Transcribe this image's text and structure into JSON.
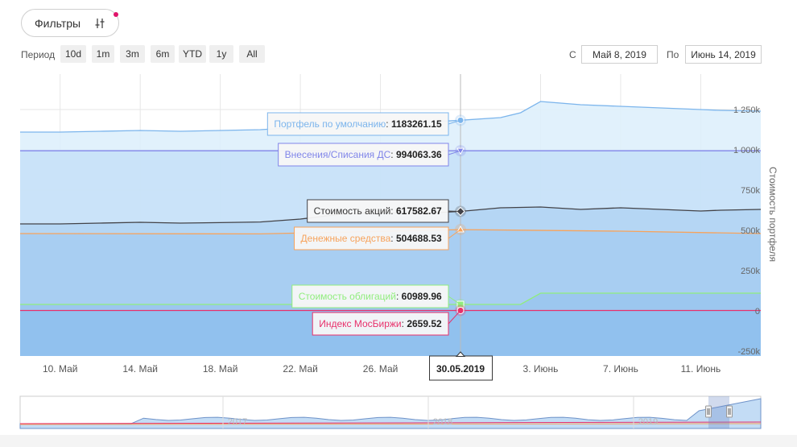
{
  "toolbar": {
    "filters_label": "Фильтры",
    "filters_icon": "sliders-icon",
    "period_label": "Период",
    "periods": [
      "10d",
      "1m",
      "3m",
      "6m",
      "YTD",
      "1y",
      "All"
    ],
    "from_label": "С",
    "from_value": "Май 8, 2019",
    "to_label": "По",
    "to_value": "Июнь 14, 2019"
  },
  "colors": {
    "accent": "#e0146a",
    "portfolio": "#7cb5ec",
    "deposits": "#8085e9",
    "stocks": "#434348",
    "cash": "#f7a35c",
    "bonds": "#90ed7d",
    "index": "#e8306b"
  },
  "chart_data": {
    "type": "area",
    "ylabel": "Стоимость портфеля",
    "ylim": [
      -250000,
      1400000
    ],
    "yticks": [
      -250000,
      0,
      250000,
      500000,
      750000,
      1000000,
      1250000
    ],
    "ytick_labels": [
      "-250k",
      "0",
      "250k",
      "500k",
      "750k",
      "1 000k",
      "1 250k"
    ],
    "x_start": "2019-05-08",
    "x_end": "2019-06-14",
    "xtick_dates": [
      "2019-05-10",
      "2019-05-14",
      "2019-05-18",
      "2019-05-22",
      "2019-05-26",
      "2019-06-03",
      "2019-06-07",
      "2019-06-11"
    ],
    "xtick_labels": [
      "10. Май",
      "14. Май",
      "18. Май",
      "22. Май",
      "26. Май",
      "3. Июнь",
      "7. Июнь",
      "11. Июнь"
    ],
    "crosshair_date": "2019-05-30",
    "crosshair_label": "30.05.2019",
    "series": [
      {
        "name": "Портфель по умолчанию",
        "tooltip_value": "1183261.15",
        "marker": "circle",
        "side": "left",
        "x": [
          "2019-05-08",
          "2019-05-10",
          "2019-05-12",
          "2019-05-14",
          "2019-05-16",
          "2019-05-18",
          "2019-05-20",
          "2019-05-22",
          "2019-05-24",
          "2019-05-26",
          "2019-05-28",
          "2019-05-30",
          "2019-06-01",
          "2019-06-02",
          "2019-06-03",
          "2019-06-05",
          "2019-06-07",
          "2019-06-09",
          "2019-06-11",
          "2019-06-12",
          "2019-06-14"
        ],
        "y": [
          1110000,
          1110000,
          1115000,
          1120000,
          1115000,
          1120000,
          1125000,
          1140000,
          1150000,
          1160000,
          1170000,
          1183261,
          1200000,
          1230000,
          1300000,
          1280000,
          1270000,
          1260000,
          1250000,
          1245000,
          1240000
        ]
      },
      {
        "name": "Внесения/Списания ДС",
        "tooltip_value": "994063.36",
        "marker": "triangle-down",
        "side": "left",
        "x": [
          "2019-05-08",
          "2019-06-14"
        ],
        "y": [
          994063,
          994063
        ]
      },
      {
        "name": "Стоимость акций",
        "tooltip_value": "617582.67",
        "marker": "diamond",
        "side": "left",
        "x": [
          "2019-05-08",
          "2019-05-10",
          "2019-05-12",
          "2019-05-14",
          "2019-05-16",
          "2019-05-18",
          "2019-05-20",
          "2019-05-22",
          "2019-05-24",
          "2019-05-26",
          "2019-05-28",
          "2019-05-30",
          "2019-06-01",
          "2019-06-03",
          "2019-06-05",
          "2019-06-07",
          "2019-06-09",
          "2019-06-11",
          "2019-06-12",
          "2019-06-14"
        ],
        "y": [
          540000,
          540000,
          545000,
          550000,
          545000,
          548000,
          552000,
          570000,
          600000,
          610000,
          605000,
          617582,
          640000,
          645000,
          630000,
          640000,
          630000,
          620000,
          625000,
          630000
        ]
      },
      {
        "name": "Денежные средства",
        "tooltip_value": "504688.53",
        "marker": "triangle",
        "side": "left",
        "x": [
          "2019-05-08",
          "2019-05-20",
          "2019-05-30",
          "2019-06-07",
          "2019-06-14"
        ],
        "y": [
          480000,
          478000,
          504688,
          495000,
          480000
        ]
      },
      {
        "name": "Стоимость облигаций",
        "tooltip_value": "60989.96",
        "marker": "square",
        "side": "left",
        "x": [
          "2019-05-08",
          "2019-05-30",
          "2019-06-01",
          "2019-06-02",
          "2019-06-03",
          "2019-06-14"
        ],
        "y": [
          40000,
          40000,
          40000,
          40000,
          110000,
          110000
        ]
      },
      {
        "name": "Индекс МосБиржи",
        "tooltip_value": "2659.52",
        "marker": "circle",
        "side": "left",
        "x": [
          "2019-05-08",
          "2019-06-14"
        ],
        "y": [
          2659,
          2659
        ]
      }
    ],
    "navigator": {
      "labels": [
        "2017",
        "2018",
        "2019"
      ]
    }
  }
}
